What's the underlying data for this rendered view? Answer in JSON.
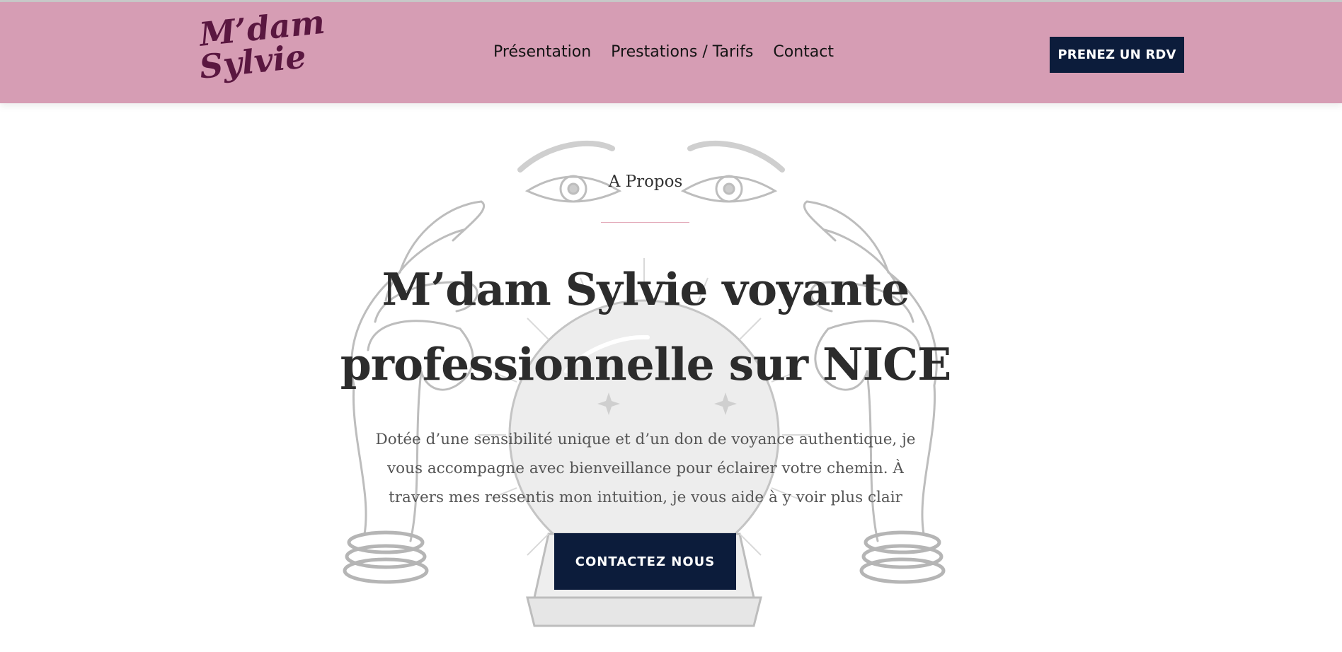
{
  "header": {
    "logo_line1": "M’dam",
    "logo_line2": "Sylvie",
    "nav": [
      "Présentation",
      "Prestations / Tarifs",
      "Contact"
    ],
    "rdv_button": "PRENEZ UN RDV"
  },
  "hero": {
    "kicker": "A Propos",
    "headline_line1": "M’dam Sylvie voyante",
    "headline_line2": "professionnelle sur NICE",
    "description_line1": "Dotée d’une sensibilité unique et d’un don de voyance authentique, je",
    "description_line2": "vous accompagne avec bienveillance pour éclairer votre chemin. À",
    "description_line3": "travers mes ressentis mon intuition, je vous aide à y voir plus clair",
    "cta_button": "CONTACTEZ NOUS"
  },
  "colors": {
    "header_bg": "#d69db4",
    "logo": "#5a1740",
    "button_bg": "#0c1c3b",
    "divider": "#e3a9b9"
  },
  "icons": {
    "background_illustration": "crystal-ball-hands-eyes-illustration"
  }
}
